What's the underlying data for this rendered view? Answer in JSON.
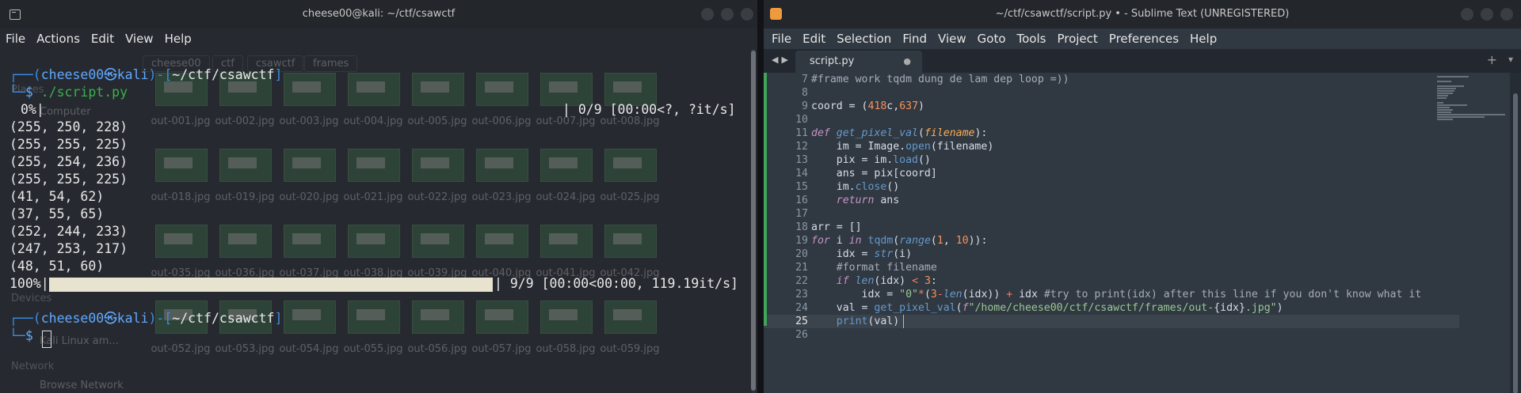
{
  "terminal": {
    "title": "cheese00@kali: ~/ctf/csawctf",
    "menu": [
      "File",
      "Actions",
      "Edit",
      "View",
      "Help"
    ],
    "prompt1": {
      "user": "cheese00",
      "host": "kali",
      "path": "~/ctf/csawctf",
      "command": "./script.py"
    },
    "progress_start": {
      "percent": "0%|",
      "status": "| 0/9 [00:00<?, ?it/s]"
    },
    "outputs": [
      "(255, 250, 228)",
      "(255, 255, 225)",
      "(255, 254, 236)",
      "(255, 255, 225)",
      "(41, 54, 62)",
      "(37, 55, 65)",
      "(252, 244, 233)",
      "(247, 253, 217)",
      "(48, 51, 60)"
    ],
    "progress_end": {
      "percent": "100%|",
      "status": "| 9/9 [00:00<00:00, 119.19it/s]",
      "fill_fraction": 1.0
    },
    "prompt2": {
      "user": "cheese00",
      "host": "kali",
      "path": "~/ctf/csawctf"
    }
  },
  "file_manager_bg": {
    "tabs": [
      "cheese00",
      "ctf",
      "csawctf",
      "frames"
    ],
    "sidebar": {
      "places": "Places",
      "computer": "Computer",
      "devices": "Devices",
      "device_item": "Kali Linux am...",
      "network": "Network",
      "browse": "Browse Network"
    },
    "files": [
      [
        "out-001.jpg",
        "out-002.jpg",
        "out-003.jpg",
        "out-004.jpg",
        "out-005.jpg",
        "out-006.jpg",
        "out-007.jpg",
        "out-008.jpg"
      ],
      [
        "out-018.jpg",
        "out-019.jpg",
        "out-020.jpg",
        "out-021.jpg",
        "out-022.jpg",
        "out-023.jpg",
        "out-024.jpg",
        "out-025.jpg"
      ],
      [
        "out-035.jpg",
        "out-036.jpg",
        "out-037.jpg",
        "out-038.jpg",
        "out-039.jpg",
        "out-040.jpg",
        "out-041.jpg",
        "out-042.jpg"
      ],
      [
        "out-052.jpg",
        "out-053.jpg",
        "out-054.jpg",
        "out-055.jpg",
        "out-056.jpg",
        "out-057.jpg",
        "out-058.jpg",
        "out-059.jpg"
      ]
    ]
  },
  "editor": {
    "title": "~/ctf/csawctf/script.py • - Sublime Text (UNREGISTERED)",
    "menu": [
      "File",
      "Edit",
      "Selection",
      "Find",
      "View",
      "Goto",
      "Tools",
      "Project",
      "Preferences",
      "Help"
    ],
    "tab_label": "script.py",
    "tab_modified": "●",
    "line_numbers": [
      "7",
      "8",
      "9",
      "10",
      "11",
      "12",
      "13",
      "14",
      "15",
      "16",
      "17",
      "18",
      "19",
      "20",
      "21",
      "22",
      "23",
      "24",
      "25",
      "26"
    ],
    "current_line": "25",
    "code": {
      "l7": "#frame work tqdm dung de lam dep loop =))",
      "l9_var": "coord",
      "l9_eq": " = (",
      "l9_n1": "418",
      "l9_c": "c,",
      "l9_n2": "637",
      "l9_close": ")",
      "l11_def": "def ",
      "l11_name": "get_pixel_val",
      "l11_p1": "(",
      "l11_param": "filename",
      "l11_p2": "):",
      "l12_a": "    im = Image.",
      "l12_fn": "open",
      "l12_b": "(filename)",
      "l13_a": "    pix = im.",
      "l13_fn": "load",
      "l13_b": "()",
      "l14": "    ans = pix[coord]",
      "l15_a": "    im.",
      "l15_fn": "close",
      "l15_b": "()",
      "l16_kw": "    return",
      "l16_b": " ans",
      "l18": "arr = []",
      "l19_for": "for",
      "l19_a": " i ",
      "l19_in": "in",
      "l19_b": " ",
      "l19_fn": "tqdm",
      "l19_c": "(",
      "l19_rng": "range",
      "l19_d": "(",
      "l19_n1": "1",
      "l19_e": ", ",
      "l19_n2": "10",
      "l19_f": ")):",
      "l20_a": "    idx = ",
      "l20_fn": "str",
      "l20_b": "(i)",
      "l21": "    #format filename",
      "l22_if": "    if",
      "l22_a": " ",
      "l22_fn": "len",
      "l22_b": "(idx) ",
      "l22_op": "<",
      "l22_c": " ",
      "l22_n": "3",
      "l22_d": ":",
      "l23_a": "        idx = ",
      "l23_s": "\"0\"",
      "l23_op": "*",
      "l23_b": "(",
      "l23_n": "3",
      "l23_op2": "-",
      "l23_fn": "len",
      "l23_c": "(idx)) ",
      "l23_op3": "+",
      "l23_d": " idx ",
      "l23_cm": "#try to print(idx) after this line if you don't know what it",
      "l24_a": "    val = ",
      "l24_fn": "get_pixel_val",
      "l24_b": "(",
      "l24_f": "f",
      "l24_s": "\"/home/cheese00/ctf/csawctf/frames/out-",
      "l24_i": "{idx}",
      "l24_s2": ".jpg\"",
      "l24_c": ")",
      "l25_a": "    ",
      "l25_fn": "print",
      "l25_b": "(val)"
    }
  }
}
